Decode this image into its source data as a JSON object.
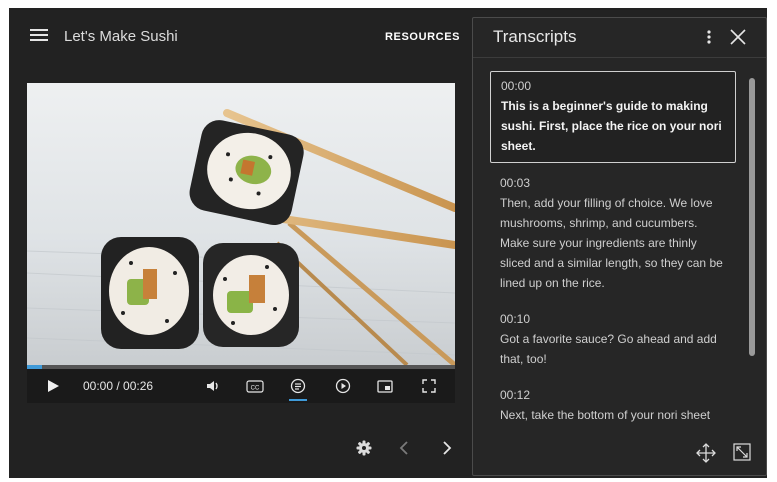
{
  "header": {
    "course_title": "Let's Make Sushi",
    "resources_label": "RESOURCES"
  },
  "player": {
    "current_time": "00:00",
    "duration": "00:26",
    "time_separator": " / ",
    "progress_fraction": 0.035,
    "accent_color": "#3f9ad8",
    "controls": [
      "play-icon",
      "volume-icon",
      "closed-captions-icon",
      "transcript-icon",
      "playback-speed-icon",
      "picture-in-picture-icon",
      "fullscreen-icon"
    ],
    "cc_label": "CC"
  },
  "bottom_nav": {
    "icons": [
      "gear-icon",
      "chevron-left-icon",
      "chevron-right-icon"
    ]
  },
  "transcript": {
    "title": "Transcripts",
    "cues": [
      {
        "time": "00:00",
        "text": "This is a beginner's guide to making sushi. First, place the rice on your nori sheet.",
        "active": true
      },
      {
        "time": "00:03",
        "text": "Then, add your filling of choice. We love mushrooms, shrimp, and cucumbers. Make sure your ingredients are thinly sliced and a similar length, so they can be lined up on the rice.",
        "active": false
      },
      {
        "time": "00:10",
        "text": "Got a favorite sauce? Go ahead and add that, too!",
        "active": false
      },
      {
        "time": "00:12",
        "text": "Next, take the bottom of your nori sheet and roll it up so that the bottom meets the",
        "active": false
      }
    ]
  }
}
